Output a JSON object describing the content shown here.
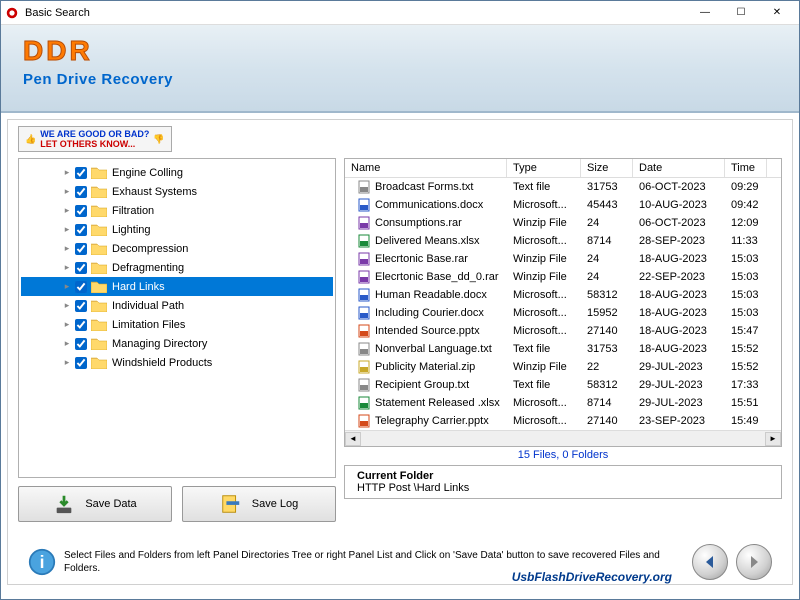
{
  "window": {
    "title": "Basic Search",
    "minimize": "—",
    "maximize": "☐",
    "close": "✕"
  },
  "header": {
    "logo": "DDR",
    "subtitle": "Pen Drive Recovery"
  },
  "promo": {
    "line1": "WE ARE GOOD OR BAD?",
    "line2": "LET OTHERS KNOW..."
  },
  "tree": {
    "items": [
      {
        "label": "Engine Colling"
      },
      {
        "label": "Exhaust Systems"
      },
      {
        "label": "Filtration"
      },
      {
        "label": "Lighting"
      },
      {
        "label": "Decompression"
      },
      {
        "label": "Defragmenting"
      },
      {
        "label": "Hard Links",
        "selected": true
      },
      {
        "label": "Individual Path"
      },
      {
        "label": "Limitation Files"
      },
      {
        "label": "Managing Directory"
      },
      {
        "label": "Windshield Products"
      }
    ]
  },
  "list": {
    "headers": {
      "name": "Name",
      "type": "Type",
      "size": "Size",
      "date": "Date",
      "time": "Time"
    },
    "rows": [
      {
        "icon": "txt",
        "name": "Broadcast Forms.txt",
        "type": "Text file",
        "size": "31753",
        "date": "06-OCT-2023",
        "time": "09:29"
      },
      {
        "icon": "docx",
        "name": "Communications.docx",
        "type": "Microsoft...",
        "size": "45443",
        "date": "10-AUG-2023",
        "time": "09:42"
      },
      {
        "icon": "rar",
        "name": "Consumptions.rar",
        "type": "Winzip File",
        "size": "24",
        "date": "06-OCT-2023",
        "time": "12:09"
      },
      {
        "icon": "xlsx",
        "name": "Delivered Means.xlsx",
        "type": "Microsoft...",
        "size": "8714",
        "date": "28-SEP-2023",
        "time": "11:33"
      },
      {
        "icon": "rar",
        "name": "Elecrtonic Base.rar",
        "type": "Winzip File",
        "size": "24",
        "date": "18-AUG-2023",
        "time": "15:03"
      },
      {
        "icon": "rar",
        "name": "Elecrtonic Base_dd_0.rar",
        "type": "Winzip File",
        "size": "24",
        "date": "22-SEP-2023",
        "time": "15:03"
      },
      {
        "icon": "docx",
        "name": "Human Readable.docx",
        "type": "Microsoft...",
        "size": "58312",
        "date": "18-AUG-2023",
        "time": "15:03"
      },
      {
        "icon": "docx",
        "name": "Including Courier.docx",
        "type": "Microsoft...",
        "size": "15952",
        "date": "18-AUG-2023",
        "time": "15:03"
      },
      {
        "icon": "pptx",
        "name": "Intended Source.pptx",
        "type": "Microsoft...",
        "size": "27140",
        "date": "18-AUG-2023",
        "time": "15:47"
      },
      {
        "icon": "txt",
        "name": "Nonverbal Language.txt",
        "type": "Text file",
        "size": "31753",
        "date": "18-AUG-2023",
        "time": "15:52"
      },
      {
        "icon": "zip",
        "name": "Publicity Material.zip",
        "type": "Winzip File",
        "size": "22",
        "date": "29-JUL-2023",
        "time": "15:52"
      },
      {
        "icon": "txt",
        "name": "Recipient Group.txt",
        "type": "Text file",
        "size": "58312",
        "date": "29-JUL-2023",
        "time": "17:33"
      },
      {
        "icon": "xlsx",
        "name": "Statement Released .xlsx",
        "type": "Microsoft...",
        "size": "8714",
        "date": "29-JUL-2023",
        "time": "15:51"
      },
      {
        "icon": "pptx",
        "name": "Telegraphy Carrier.pptx",
        "type": "Microsoft...",
        "size": "27140",
        "date": "23-SEP-2023",
        "time": "15:49"
      }
    ],
    "status": "15 Files, 0 Folders"
  },
  "current_folder": {
    "title": "Current Folder",
    "path": "HTTP Post \\Hard Links"
  },
  "buttons": {
    "save_data": "Save Data",
    "save_log": "Save Log"
  },
  "footer": {
    "text": "Select Files and Folders from left Panel Directories Tree or right Panel List and Click on 'Save Data' button to save recovered Files and Folders.",
    "brand": "UsbFlashDriveRecovery.org"
  }
}
